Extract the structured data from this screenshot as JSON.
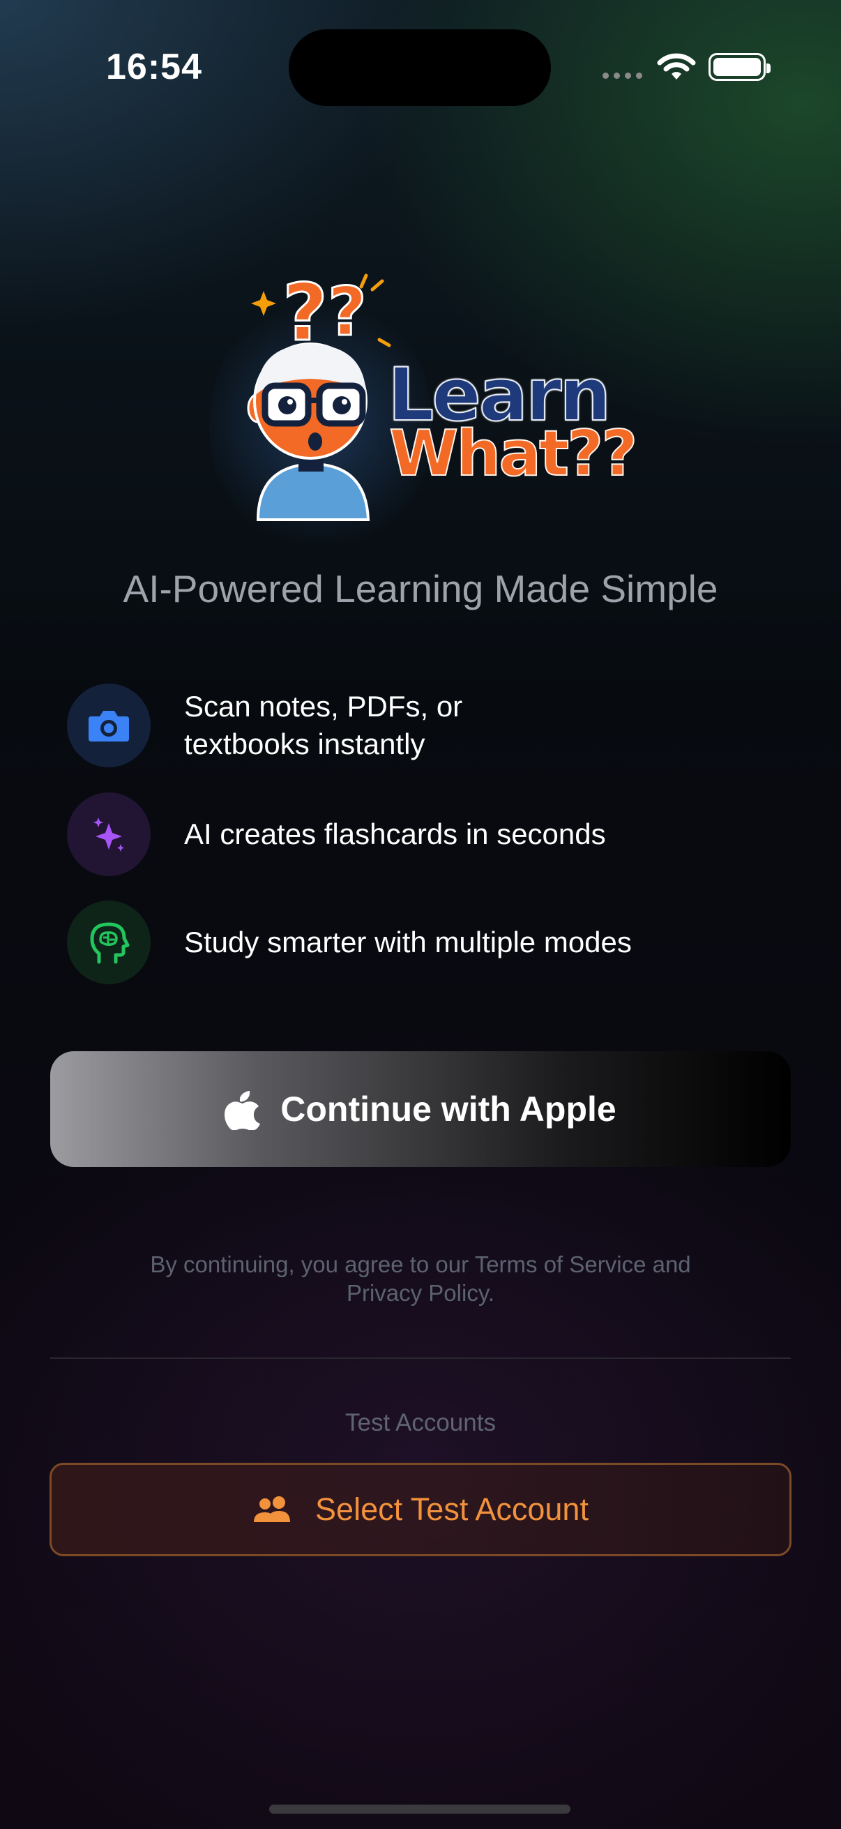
{
  "status_bar": {
    "time": "16:54"
  },
  "logo": {
    "line1": "Learn",
    "line2": "What??"
  },
  "tagline": "AI-Powered Learning Made Simple",
  "features": [
    {
      "icon": "camera-icon",
      "text_line1": "Scan notes, PDFs, or",
      "text_line2": "textbooks instantly",
      "color": "#3b82f6"
    },
    {
      "icon": "sparkles-icon",
      "text": "AI creates flashcards in seconds",
      "color": "#a855f7"
    },
    {
      "icon": "brain-head-icon",
      "text": "Study smarter with multiple modes",
      "color": "#22c55e"
    }
  ],
  "apple_button": {
    "label": "Continue with Apple",
    "icon": "apple-logo-icon"
  },
  "terms": {
    "line1": "By continuing, you agree to our Terms of Service and",
    "line2": "Privacy Policy."
  },
  "test_accounts": {
    "heading": "Test Accounts",
    "button_label": "Select Test Account",
    "icon": "people-icon",
    "accent": "#f2923c"
  }
}
